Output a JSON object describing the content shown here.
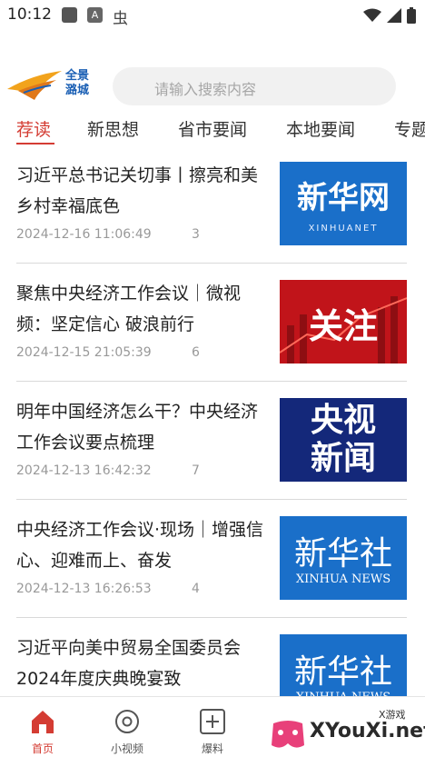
{
  "status_bar": {
    "time": "10:12",
    "icon2_label": "A",
    "icon3_label": "虫"
  },
  "header": {
    "logo_text_line1": "全景",
    "logo_text_line2": "潞城",
    "search_placeholder": "请输入搜索内容"
  },
  "tabs": [
    {
      "label": "荐读",
      "active": true
    },
    {
      "label": "新思想",
      "active": false
    },
    {
      "label": "省市要闻",
      "active": false
    },
    {
      "label": "本地要闻",
      "active": false
    },
    {
      "label": "专题",
      "active": false
    }
  ],
  "feed": [
    {
      "title": "习近平总书记关切事丨擦亮和美乡村幸福底色",
      "time": "2024-12-16 11:06:49",
      "count": "3",
      "thumb": {
        "main": "新华网",
        "sub": "XINHUANET"
      }
    },
    {
      "title": "聚焦中央经济工作会议｜微视频：坚定信心 破浪前行",
      "time": "2024-12-15 21:05:39",
      "count": "6",
      "thumb": {
        "main": "关注",
        "sub": ""
      }
    },
    {
      "title": "明年中国经济怎么干？中央经济工作会议要点梳理",
      "time": "2024-12-13 16:42:32",
      "count": "7",
      "thumb": {
        "main": "央视",
        "main2": "新闻",
        "sub": ""
      }
    },
    {
      "title": "中央经济工作会议·现场｜增强信心、迎难而上、奋发",
      "time": "2024-12-13 16:26:53",
      "count": "4",
      "thumb": {
        "main": "新华社",
        "sub": "XINHUA NEWS"
      }
    },
    {
      "title": "习近平向美中贸易全国委员会2024年度庆典晚宴致",
      "time": "",
      "count": "",
      "thumb": {
        "main": "新华社",
        "sub": "XINHUA NEWS"
      }
    }
  ],
  "bottom_nav": [
    {
      "label": "首页",
      "icon": "home-icon",
      "active": true
    },
    {
      "label": "小视频",
      "icon": "video-icon",
      "active": false
    },
    {
      "label": "爆料",
      "icon": "plus-box-icon",
      "active": false
    }
  ],
  "watermark": {
    "text": "XYouXi.net",
    "sub": "X游戏"
  },
  "colors": {
    "accent": "#d43c33",
    "xinhua_blue": "#1a6fc9",
    "cctv_navy": "#14287a",
    "focus_red": "#c1141a"
  }
}
